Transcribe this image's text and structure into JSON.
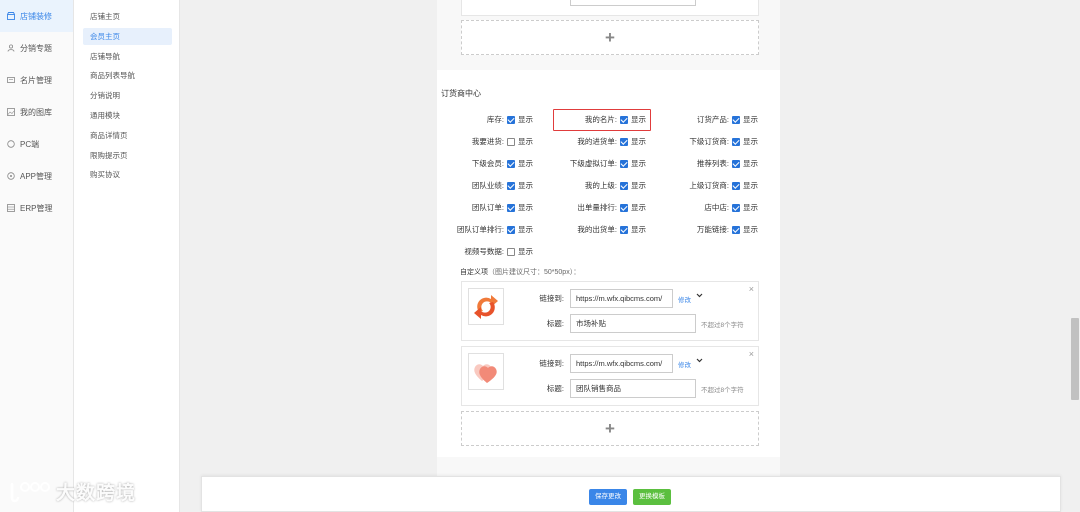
{
  "sidebar": {
    "items": [
      {
        "label": "店铺装修",
        "icon": "shop-icon",
        "active": true
      },
      {
        "label": "分销专题",
        "icon": "distribution-icon",
        "active": false
      },
      {
        "label": "名片管理",
        "icon": "card-icon",
        "active": false
      },
      {
        "label": "我的图库",
        "icon": "image-icon",
        "active": false
      },
      {
        "label": "PC端",
        "icon": "pc-icon",
        "active": false
      },
      {
        "label": "APP管理",
        "icon": "app-icon",
        "active": false
      },
      {
        "label": "ERP管理",
        "icon": "erp-icon",
        "active": false
      }
    ]
  },
  "subnav": {
    "items": [
      {
        "label": "店铺主页",
        "active": false
      },
      {
        "label": "会员主页",
        "active": true
      },
      {
        "label": "店铺导航",
        "active": false
      },
      {
        "label": "商品列表导航",
        "active": false
      },
      {
        "label": "分销说明",
        "active": false
      },
      {
        "label": "通用模块",
        "active": false
      },
      {
        "label": "商品详情页",
        "active": false
      },
      {
        "label": "限购提示页",
        "active": false
      },
      {
        "label": "购买协议",
        "active": false
      }
    ]
  },
  "section": {
    "title": "订货商中心",
    "show_label": "显示",
    "settings": [
      {
        "label": "库存:",
        "checked": true
      },
      {
        "label": "我的名片:",
        "checked": true
      },
      {
        "label": "订货产品:",
        "checked": true
      },
      {
        "label": "我要进货:",
        "checked": false
      },
      {
        "label": "我的进货单:",
        "checked": true
      },
      {
        "label": "下级订货商:",
        "checked": true
      },
      {
        "label": "下级会员:",
        "checked": true
      },
      {
        "label": "下级虚拟订单:",
        "checked": true
      },
      {
        "label": "推荐列表:",
        "checked": true
      },
      {
        "label": "团队业绩:",
        "checked": true
      },
      {
        "label": "我的上级:",
        "checked": true
      },
      {
        "label": "上级订货商:",
        "checked": true
      },
      {
        "label": "团队订单:",
        "checked": true
      },
      {
        "label": "出单量排行:",
        "checked": true
      },
      {
        "label": "店中店:",
        "checked": true
      },
      {
        "label": "团队订单排行:",
        "checked": true
      },
      {
        "label": "我的出货单:",
        "checked": true
      },
      {
        "label": "万能链接:",
        "checked": true
      },
      {
        "label": "视频号数据:",
        "checked": false
      }
    ]
  },
  "custom": {
    "title": "自定义项",
    "hint": "（图片建议尺寸：50*50px）：",
    "link_label": "链接到:",
    "title_label": "标题:",
    "edit_label": "修改",
    "limit_text": "不超过8个字符",
    "items": [
      {
        "url": "https://m.wfx.qibcms.com/",
        "title": "市场补贴",
        "icon": "refresh-arrows-icon"
      },
      {
        "url": "https://m.wfx.qibcms.com/",
        "title": "团队销售商品",
        "icon": "heart-icon"
      }
    ]
  },
  "add_symbol": "+",
  "close_symbol": "×",
  "footer": {
    "save_label": "保存更改",
    "template_label": "更换模板"
  },
  "watermark": {
    "text": "大数跨境"
  },
  "colors": {
    "accent": "#3a86e8",
    "checkbox": "#2673d9",
    "highlight": "#e03c3c",
    "save_button": "#3a86e8",
    "template_button": "#5bbf3f"
  }
}
